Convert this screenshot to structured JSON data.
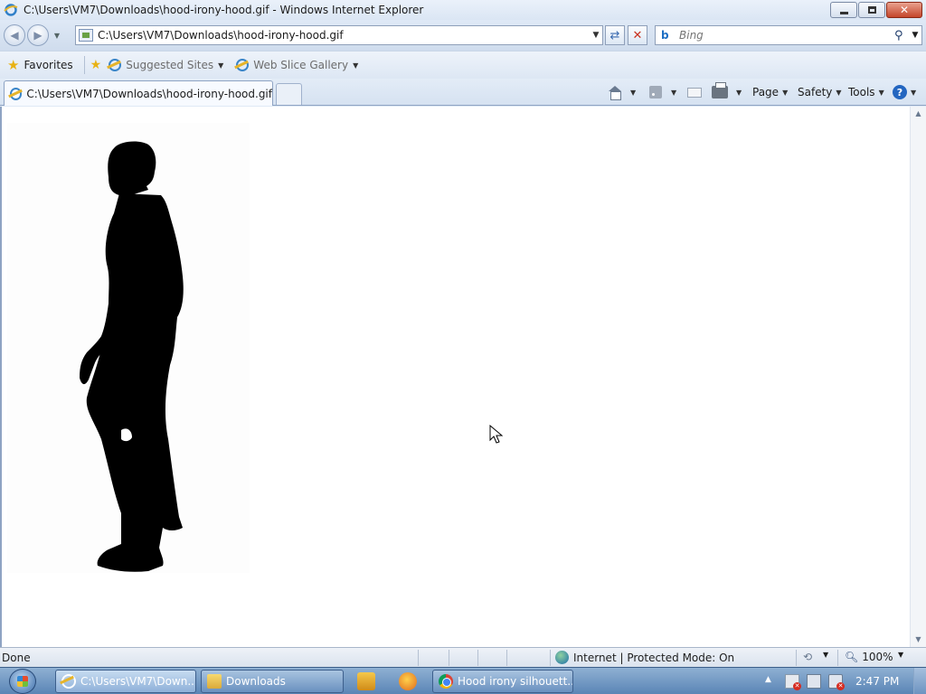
{
  "window": {
    "title": "C:\\Users\\VM7\\Downloads\\hood-irony-hood.gif - Windows Internet Explorer"
  },
  "nav": {
    "address": "C:\\Users\\VM7\\Downloads\\hood-irony-hood.gif",
    "search_placeholder": "Bing"
  },
  "favorites": {
    "label": "Favorites",
    "links": [
      "Suggested Sites",
      "Web Slice Gallery"
    ]
  },
  "tabs": [
    {
      "label": "C:\\Users\\VM7\\Downloads\\hood-irony-hood.gif",
      "active": true
    }
  ],
  "commandbar": {
    "page": "Page",
    "safety": "Safety",
    "tools": "Tools"
  },
  "content": {
    "image": "silhouette-of-walking-man"
  },
  "status": {
    "text": "Done",
    "zone": "Internet | Protected Mode: On",
    "zoom": "100%"
  },
  "taskbar": {
    "buttons": [
      {
        "label": "C:\\Users\\VM7\\Down...",
        "icon": "ie-icon"
      },
      {
        "label": "Downloads",
        "icon": "folder-icon"
      },
      {
        "label": "Hood irony silhouett...",
        "icon": "chrome-icon"
      }
    ],
    "clock": "2:47 PM"
  }
}
